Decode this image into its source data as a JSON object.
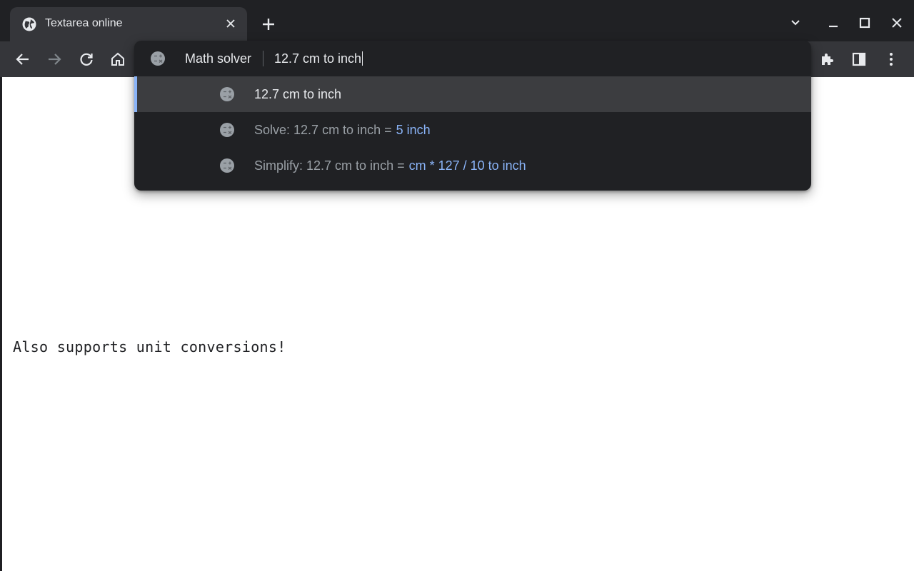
{
  "tab": {
    "title": "Textarea online",
    "favicon": "globe-icon"
  },
  "toolbar": {
    "icons": [
      "back-arrow-icon",
      "forward-arrow-icon",
      "reload-icon",
      "home-icon",
      "extensions-icon",
      "side-panel-icon",
      "more-vert-icon"
    ]
  },
  "omnibox": {
    "keyword": "Math solver",
    "query": "12.7 cm to inch",
    "suggestions": [
      {
        "text": "12.7 cm to inch"
      },
      {
        "prefix": "Solve: 12.7 cm to inch =",
        "answer": "5 inch"
      },
      {
        "prefix": "Simplify: 12.7 cm to inch =",
        "answer": "cm * 127 / 10 to inch"
      }
    ]
  },
  "page": {
    "text": "Also supports unit conversions!"
  },
  "colors": {
    "frame": "#202124",
    "toolbar": "#35363a",
    "accent": "#8ab4f8",
    "text": "#e8eaed",
    "dim": "#9aa0a6"
  }
}
